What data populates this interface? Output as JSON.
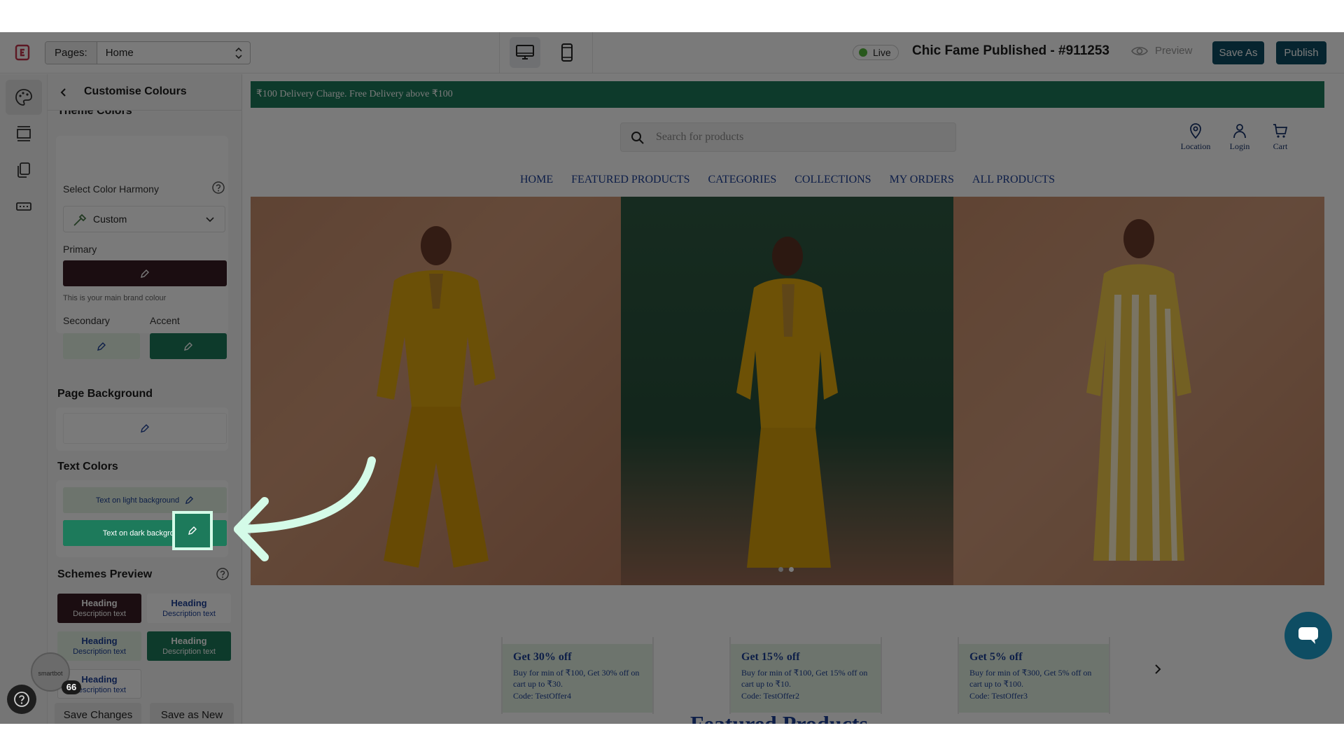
{
  "topbar": {
    "pages_label": "Pages:",
    "page_selected": "Home",
    "live_label": "Live",
    "site_title": "Chic Fame Published - #911253",
    "preview_label": "Preview",
    "save_as_label": "Save As",
    "publish_label": "Publish"
  },
  "panel": {
    "title": "Customise Colours",
    "theme_colors_title": "Theme Colors",
    "harmony_label": "Select Color Harmony",
    "harmony_value": "Custom",
    "primary_label": "Primary",
    "primary_hint": "This is your main brand colour",
    "secondary_label": "Secondary",
    "accent_label": "Accent",
    "page_background_title": "Page Background",
    "text_colors_title": "Text Colors",
    "text_light_label": "Text on light background",
    "text_dark_label": "Text on dark background",
    "schemes_title": "Schemes Preview",
    "schemes": [
      {
        "heading": "Heading",
        "description": "Description text"
      },
      {
        "heading": "Heading",
        "description": "Description text"
      },
      {
        "heading": "Heading",
        "description": "Description text"
      },
      {
        "heading": "Heading",
        "description": "Description text"
      },
      {
        "heading": "Heading",
        "description": "Description text"
      }
    ],
    "save_changes_label": "Save Changes",
    "save_as_new_label": "Save as New"
  },
  "colors": {
    "primary": "#3a1c24",
    "secondary": "#e3f2e3",
    "accent": "#1d7a5b",
    "page_background": "#ffffff",
    "text_light_bg": "#1c3f96",
    "text_dark_bg": "#ffffff",
    "brand_dark": "#0e4d63"
  },
  "store": {
    "announcement": "₹100 Delivery Charge. Free Delivery above ₹100",
    "search_placeholder": "Search for products",
    "header_icons": [
      {
        "label": "Location",
        "icon": "location-pin-icon"
      },
      {
        "label": "Login",
        "icon": "user-icon"
      },
      {
        "label": "Cart",
        "icon": "cart-icon"
      }
    ],
    "nav": [
      "HOME",
      "FEATURED PRODUCTS",
      "CATEGORIES",
      "COLLECTIONS",
      "MY ORDERS",
      "ALL PRODUCTS"
    ],
    "offers": [
      {
        "title": "Get 30% off",
        "body": "Buy for min of ₹100, Get 30% off on cart up to ₹30.",
        "code": "Code: TestOffer4"
      },
      {
        "title": "Get 15% off",
        "body": "Buy for min of ₹100, Get 15% off on cart up to ₹10.",
        "code": "Code: TestOffer2"
      },
      {
        "title": "Get 5% off",
        "body": "Buy for min of ₹300, Get 5% off on cart up to ₹100.",
        "code": "Code: TestOffer3"
      }
    ],
    "featured_title": "Featured Products"
  },
  "widgets": {
    "smartbot_label": "smartbot",
    "notification_count": "66"
  }
}
